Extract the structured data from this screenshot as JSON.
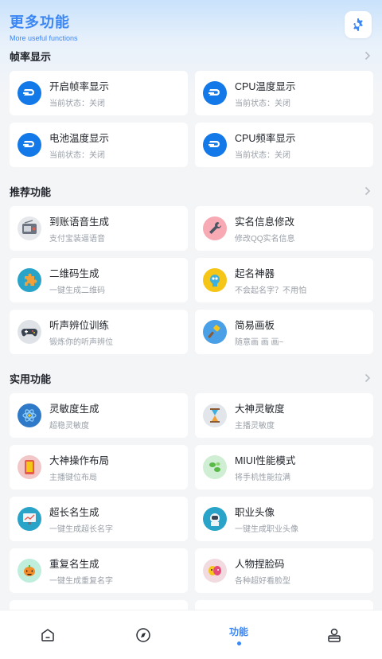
{
  "header": {
    "title": "更多功能",
    "subtitle": "More useful functions"
  },
  "sections": [
    {
      "label": "帧率显示"
    },
    {
      "label": "推荐功能"
    },
    {
      "label": "实用功能"
    }
  ],
  "frame_cards": [
    {
      "title": "开启帧率显示",
      "status": "当前状态：关闭",
      "icon": "dashboard-icon"
    },
    {
      "title": "CPU温度显示",
      "status": "当前状态：关闭",
      "icon": "dashboard-icon"
    },
    {
      "title": "电池温度显示",
      "status": "当前状态：关闭",
      "icon": "dashboard-icon"
    },
    {
      "title": "CPU频率显示",
      "status": "当前状态：关闭",
      "icon": "dashboard-icon"
    }
  ],
  "recommend_cards": [
    {
      "title": "到账语音生成",
      "desc": "支付宝装逼语音",
      "icon": "radio-icon"
    },
    {
      "title": "实名信息修改",
      "desc": "修改QQ实名信息",
      "icon": "wrench-icon"
    },
    {
      "title": "二维码生成",
      "desc": "一键生成二维码",
      "icon": "qr-puzzle-icon"
    },
    {
      "title": "起名神器",
      "desc": "不会起名字？不用怕",
      "icon": "brain-icon"
    },
    {
      "title": "听声辨位训练",
      "desc": "锻炼你的听声辨位",
      "icon": "gamepad-icon"
    },
    {
      "title": "简易画板",
      "desc": "随意画 画 画~",
      "icon": "brush-icon"
    }
  ],
  "utility_cards": [
    {
      "title": "灵敏度生成",
      "desc": "超稳灵敏度",
      "icon": "atom-icon"
    },
    {
      "title": "大神灵敏度",
      "desc": "主播灵敏度",
      "icon": "hourglass-icon"
    },
    {
      "title": "大神操作布局",
      "desc": "主播键位布局",
      "icon": "tablet-icon"
    },
    {
      "title": "MIUI性能模式",
      "desc": "将手机性能拉满",
      "icon": "leaf-icon"
    },
    {
      "title": "超长名生成",
      "desc": "一键生成超长名字",
      "icon": "monitor-chart-icon"
    },
    {
      "title": "职业头像",
      "desc": "一键生成职业头像",
      "icon": "astronaut-icon"
    },
    {
      "title": "重复名生成",
      "desc": "一键生成重复名字",
      "icon": "pumpkin-icon"
    },
    {
      "title": "人物捏脸码",
      "desc": "各种超好看脸型",
      "icon": "mask-icon"
    }
  ],
  "tabs": [
    {
      "label": "",
      "icon": "home-icon"
    },
    {
      "label": "",
      "icon": "compass-icon"
    },
    {
      "label": "功能",
      "icon": ""
    },
    {
      "label": "",
      "icon": "profile-icon"
    }
  ],
  "colors": {
    "accent": "#3a86f4",
    "text": "#1f2329",
    "subtext": "#9aa0a8",
    "dash_blue": "#1479e8"
  }
}
